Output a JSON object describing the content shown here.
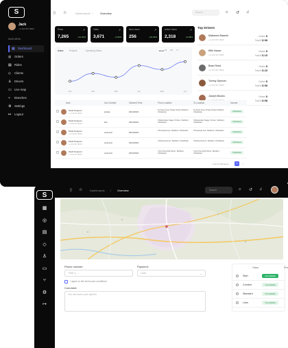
{
  "back": {
    "user": {
      "name": "Jack",
      "phone": "+1 234 567 8900"
    },
    "main_menu_label": "MAIN MENU",
    "nav": [
      {
        "icon": "dashboard-icon",
        "glyph": "▦",
        "label": "Dashboard",
        "active": true
      },
      {
        "icon": "orders-icon",
        "glyph": "◎",
        "label": "Orders"
      },
      {
        "icon": "rides-icon",
        "glyph": "▤",
        "label": "Rides"
      },
      {
        "icon": "clients-icon",
        "glyph": "◇",
        "label": "Clients"
      },
      {
        "icon": "drivers-icon",
        "glyph": "♙",
        "label": "Drivers"
      },
      {
        "icon": "map-icon",
        "glyph": "▭",
        "label": "Live map"
      },
      {
        "icon": "branches-icon",
        "glyph": "⑂",
        "label": "Branches"
      },
      {
        "icon": "settings-icon",
        "glyph": "⚙",
        "label": "Settings"
      },
      {
        "icon": "logout-icon",
        "glyph": "↦",
        "label": "Logout"
      }
    ],
    "breadcrumb": {
      "parent": "Dashboards",
      "current": "Overview"
    },
    "search_placeholder": "Search",
    "stats": [
      {
        "label": "Rides",
        "value": "7,265",
        "change": "+11.01%"
      },
      {
        "label": "Visits",
        "value": "3,671",
        "change": "-0.03%"
      },
      {
        "label": "New Users",
        "value": "256",
        "change": "+15.03%"
      },
      {
        "label": "Active Users",
        "value": "2,318",
        "change": "+6.08%"
      }
    ],
    "chart_tabs": [
      "Users",
      "Projects",
      "Operating Status"
    ],
    "chart_ranges": [
      "Week",
      "3M",
      "6M",
      "1Y"
    ],
    "chart_data": {
      "type": "line",
      "x": [
        "Jan",
        "Feb",
        "Mar",
        "Apr",
        "May",
        "Jun"
      ],
      "series": [
        {
          "values": [
            8,
            14,
            11,
            20,
            17,
            23
          ]
        }
      ]
    },
    "top_drivers_title": "Top Drivers",
    "drivers": [
      {
        "name": "Malkamm Raamih",
        "phone": "+1 234 567 8900",
        "orders": "5",
        "total": "$ 98",
        "color": "#b07a5a"
      },
      {
        "name": "Effie Nanze",
        "phone": "+1 234 567 8900",
        "orders": "5",
        "total": "$ 15",
        "color": "#c9a27d"
      },
      {
        "name": "Brian Reed",
        "phone": "+1 234 567 8900",
        "orders": "5",
        "total": "$ 23",
        "color": "#6b6b6b"
      },
      {
        "name": "Tommy Spencer",
        "phone": "+1 234 567 8900",
        "orders": "5",
        "total": "$ 98",
        "color": "#8a5a3c"
      },
      {
        "name": "Joseph Brooks",
        "phone": "+1 234 567 8900",
        "orders": "5",
        "total": "$ 98",
        "color": "#a36b4f"
      }
    ],
    "driver_orders_label": "Orders",
    "driver_total_label": "Total $",
    "table": {
      "headers": [
        "User",
        "Car Comfort",
        "Ordered Time",
        "From Location",
        "To Location",
        "Income"
      ],
      "rows": [
        {
          "name": "David Ferguson",
          "phone": "+1 234 567 8900",
          "car": "private",
          "time": "04/12/2023",
          "from": "Su Store Area, Private Street Tashkent, Uzbekistan",
          "to": "Su Store Area, Private Street Tashkent, Uzbekistan",
          "income": "Uzbekistan"
        },
        {
          "name": "David Ferguson",
          "phone": "+1 234 567 8900",
          "car": "taxi",
          "time": "04/12/2023",
          "from": "Chilanzarskiy Nagar, Chorsu, Tashkent, Uzbekistan",
          "to": "Chilanzarskiy Nagar, Chorsu, Tashkent, Uzbekistan",
          "income": "Uzbekistan"
        },
        {
          "name": "David Ferguson",
          "phone": "+1 234 567 8900",
          "car": "economic",
          "time": "04/12/2023",
          "from": "78 Kupriyar Ave, Tashkent, Uzbekistan",
          "to": "78 Kupriyar Ave, Tashkent, Uzbekistan",
          "income": "Uzbekistan"
        },
        {
          "name": "David Ferguson",
          "phone": "+1 234 567 8900",
          "car": "economic",
          "time": "04/12/2023",
          "from": "Uchtepa Avenue, Tashkent, Uzbekistan",
          "to": "Uchtepa Avenue, Tashkent, Uzbekistan",
          "income": "Uzbekistan"
        },
        {
          "name": "David Ferguson",
          "phone": "+1 234 567 8900",
          "car": "economic",
          "time": "04/12/2023",
          "from": "Yusuf Xos Hojib Street, Tashkent, Uzbekistan",
          "to": "Yusuf Xos Hojib Street, Tashkent, Uzbekistan",
          "income": "Uzbekistan"
        }
      ]
    },
    "pagination": {
      "info": "1-10 of 100 items",
      "page": "1"
    }
  },
  "front": {
    "breadcrumb": {
      "parent": "Dashboards",
      "current": "Overview"
    },
    "search_placeholder": "Search",
    "nav_icons": [
      {
        "icon": "dashboard-icon",
        "glyph": "▦"
      },
      {
        "icon": "orders-icon",
        "glyph": "◎"
      },
      {
        "icon": "rides-icon",
        "glyph": "▤"
      },
      {
        "icon": "clients-icon",
        "glyph": "◇"
      },
      {
        "icon": "drivers-icon",
        "glyph": "♙"
      },
      {
        "icon": "map-icon",
        "glyph": "▭"
      },
      {
        "icon": "branches-icon",
        "glyph": "⑂"
      },
      {
        "icon": "settings-icon",
        "glyph": "⚙"
      },
      {
        "icon": "logout-icon",
        "glyph": "↦"
      }
    ],
    "form": {
      "phone_label": "Phone number:",
      "phone_placeholder": "+998 ( ) - -",
      "payment_label": "Payment:",
      "payment_value": "Cash",
      "agree_text": "I agree to the terms and conditions",
      "comment_label": "Comment:",
      "comment_placeholder": "You can leave your opinion"
    },
    "classes": {
      "headers": [
        "Class",
        "Price"
      ],
      "rows": [
        {
          "name": "Start",
          "badge": "Unavailable",
          "active": true
        },
        {
          "name": "Comfort",
          "badge": "Unavailable",
          "active": false
        },
        {
          "name": "Standard",
          "badge": "Unavailable",
          "active": false
        },
        {
          "name": "Lobo",
          "badge": "Unavailable",
          "active": false
        }
      ]
    }
  }
}
